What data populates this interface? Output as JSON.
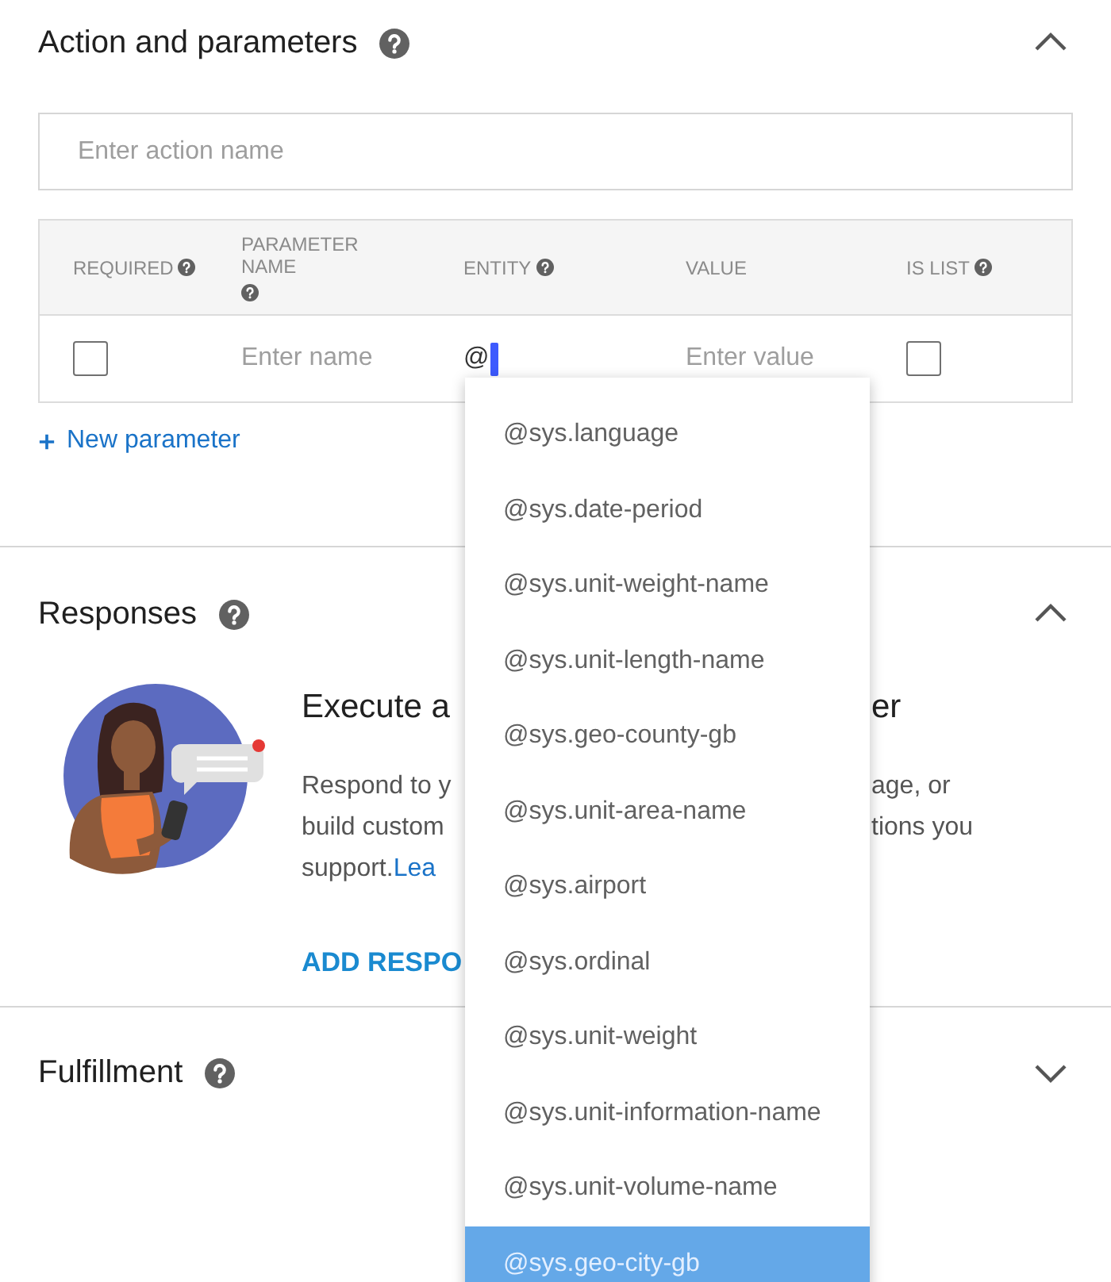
{
  "sections": [
    {
      "kind": "action",
      "title": "Action and parameters",
      "expanded": true,
      "action_field": {
        "placeholder": "Enter action name"
      },
      "table": {
        "columns": [
          {
            "label": "REQUIRED",
            "help": true
          },
          {
            "label": "PARAMETER NAME",
            "help": true
          },
          {
            "label": "ENTITY",
            "help": true
          },
          {
            "label": "VALUE",
            "help": false
          },
          {
            "label": "IS LIST",
            "help": true
          }
        ],
        "rows": [
          {
            "required": {
              "checked": false
            },
            "parameter_name": {
              "placeholder": "Enter name"
            },
            "entity": {
              "value": "@",
              "focused": true
            },
            "value": {
              "placeholder": "Enter value"
            },
            "is_list": {
              "checked": false
            }
          }
        ]
      },
      "new_parameter": "New parameter"
    },
    {
      "kind": "responses",
      "title": "Responses",
      "expanded": true,
      "heading": {
        "left": "Execute a",
        "right": "er"
      },
      "lines": [
        {
          "left": "Respond to y",
          "right": "age, or"
        },
        {
          "left": "build custom",
          "right": "tions you"
        },
        {
          "left": "support.",
          "link": "Lea"
        }
      ],
      "button": "ADD RESPO"
    },
    {
      "kind": "plain",
      "title": "Fulfillment",
      "expanded": false
    }
  ],
  "entity_suggestions": [
    {
      "label": "@sys.language",
      "selected": false
    },
    {
      "label": "@sys.date-period",
      "selected": false
    },
    {
      "label": "@sys.unit-weight-name",
      "selected": false
    },
    {
      "label": "@sys.unit-length-name",
      "selected": false
    },
    {
      "label": "@sys.geo-county-gb",
      "selected": false
    },
    {
      "label": "@sys.unit-area-name",
      "selected": false
    },
    {
      "label": "@sys.airport",
      "selected": false
    },
    {
      "label": "@sys.ordinal",
      "selected": false
    },
    {
      "label": "@sys.unit-weight",
      "selected": false
    },
    {
      "label": "@sys.unit-information-name",
      "selected": false
    },
    {
      "label": "@sys.unit-volume-name",
      "selected": false
    },
    {
      "label": "@sys.geo-city-gb",
      "selected": true
    }
  ]
}
